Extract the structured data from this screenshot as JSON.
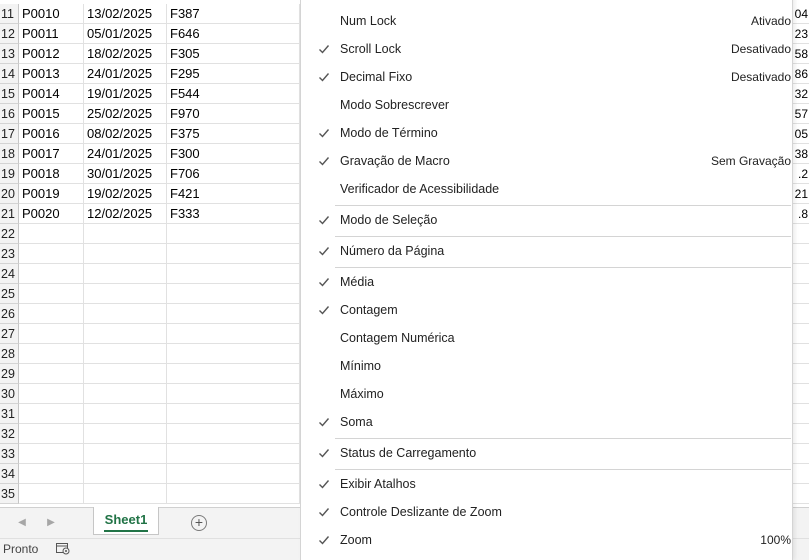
{
  "grid": {
    "rows": [
      {
        "num": "11",
        "a": "P0010",
        "b": "13/02/2025",
        "c": "F387",
        "e": "04"
      },
      {
        "num": "12",
        "a": "P0011",
        "b": "05/01/2025",
        "c": "F646",
        "e": "23"
      },
      {
        "num": "13",
        "a": "P0012",
        "b": "18/02/2025",
        "c": "F305",
        "e": "58"
      },
      {
        "num": "14",
        "a": "P0013",
        "b": "24/01/2025",
        "c": "F295",
        "e": "86"
      },
      {
        "num": "15",
        "a": "P0014",
        "b": "19/01/2025",
        "c": "F544",
        "e": "32"
      },
      {
        "num": "16",
        "a": "P0015",
        "b": "25/02/2025",
        "c": "F970",
        "e": "57"
      },
      {
        "num": "17",
        "a": "P0016",
        "b": "08/02/2025",
        "c": "F375",
        "e": "05"
      },
      {
        "num": "18",
        "a": "P0017",
        "b": "24/01/2025",
        "c": "F300",
        "e": "38"
      },
      {
        "num": "19",
        "a": "P0018",
        "b": "30/01/2025",
        "c": "F706",
        "e": ".2"
      },
      {
        "num": "20",
        "a": "P0019",
        "b": "19/02/2025",
        "c": "F421",
        "e": "21"
      },
      {
        "num": "21",
        "a": "P0020",
        "b": "12/02/2025",
        "c": "F333",
        "e": ".8"
      },
      {
        "num": "22",
        "a": "",
        "b": "",
        "c": "",
        "e": ""
      },
      {
        "num": "23",
        "a": "",
        "b": "",
        "c": "",
        "e": ""
      },
      {
        "num": "24",
        "a": "",
        "b": "",
        "c": "",
        "e": ""
      },
      {
        "num": "25",
        "a": "",
        "b": "",
        "c": "",
        "e": ""
      },
      {
        "num": "26",
        "a": "",
        "b": "",
        "c": "",
        "e": ""
      },
      {
        "num": "27",
        "a": "",
        "b": "",
        "c": "",
        "e": ""
      },
      {
        "num": "28",
        "a": "",
        "b": "",
        "c": "",
        "e": ""
      },
      {
        "num": "29",
        "a": "",
        "b": "",
        "c": "",
        "e": ""
      },
      {
        "num": "30",
        "a": "",
        "b": "",
        "c": "",
        "e": ""
      },
      {
        "num": "31",
        "a": "",
        "b": "",
        "c": "",
        "e": ""
      },
      {
        "num": "32",
        "a": "",
        "b": "",
        "c": "",
        "e": ""
      },
      {
        "num": "33",
        "a": "",
        "b": "",
        "c": "",
        "e": ""
      },
      {
        "num": "34",
        "a": "",
        "b": "",
        "c": "",
        "e": ""
      },
      {
        "num": "35",
        "a": "",
        "b": "",
        "c": "",
        "e": ""
      }
    ]
  },
  "tabbar": {
    "prev_icon": "triangle-left-icon",
    "next_icon": "triangle-right-icon",
    "sheet_tab": "Sheet1",
    "add_icon": "plus-circle-icon"
  },
  "statusbar": {
    "mode": "Pronto",
    "macro_icon": "macro-record-icon"
  },
  "menu": {
    "items": [
      {
        "id": "num-lock",
        "label": "Num Lock",
        "checked": false,
        "value": "Ativado",
        "sep_after": false
      },
      {
        "id": "scroll-lock",
        "label": "Scroll Lock",
        "checked": true,
        "value": "Desativado",
        "sep_after": false
      },
      {
        "id": "decimal-fixo",
        "label": "Decimal Fixo",
        "checked": true,
        "value": "Desativado",
        "sep_after": false
      },
      {
        "id": "modo-sobrescrever",
        "label": "Modo Sobrescrever",
        "checked": false,
        "value": "",
        "sep_after": false
      },
      {
        "id": "modo-de-termino",
        "label": "Modo de Término",
        "checked": true,
        "value": "",
        "sep_after": false
      },
      {
        "id": "gravacao-de-macro",
        "label": "Gravação de Macro",
        "checked": true,
        "value": "Sem Gravação",
        "sep_after": false
      },
      {
        "id": "verificador-acessibilidade",
        "label": "Verificador de Acessibilidade",
        "checked": false,
        "value": "",
        "sep_after": true
      },
      {
        "id": "modo-de-selecao",
        "label": "Modo de Seleção",
        "checked": true,
        "value": "",
        "sep_after": true
      },
      {
        "id": "numero-da-pagina",
        "label": "Número da Página",
        "checked": true,
        "value": "",
        "sep_after": true
      },
      {
        "id": "media",
        "label": "Média",
        "checked": true,
        "value": "",
        "sep_after": false
      },
      {
        "id": "contagem",
        "label": "Contagem",
        "checked": true,
        "value": "",
        "sep_after": false
      },
      {
        "id": "contagem-numerica",
        "label": "Contagem Numérica",
        "checked": false,
        "value": "",
        "sep_after": false
      },
      {
        "id": "minimo",
        "label": "Mínimo",
        "checked": false,
        "value": "",
        "sep_after": false
      },
      {
        "id": "maximo",
        "label": "Máximo",
        "checked": false,
        "value": "",
        "sep_after": false
      },
      {
        "id": "soma",
        "label": "Soma",
        "checked": true,
        "value": "",
        "sep_after": true
      },
      {
        "id": "status-de-carregamento",
        "label": "Status de Carregamento",
        "checked": true,
        "value": "",
        "sep_after": true
      },
      {
        "id": "exibir-atalhos",
        "label": "Exibir Atalhos",
        "checked": true,
        "value": "",
        "sep_after": false
      },
      {
        "id": "controle-deslizante-zoom",
        "label": "Controle Deslizante de Zoom",
        "checked": true,
        "value": "",
        "sep_after": false
      },
      {
        "id": "zoom",
        "label": "Zoom",
        "checked": true,
        "value": "100%",
        "sep_after": false
      }
    ]
  },
  "colors": {
    "accent_green": "#217346",
    "check_gray": "#555555"
  }
}
